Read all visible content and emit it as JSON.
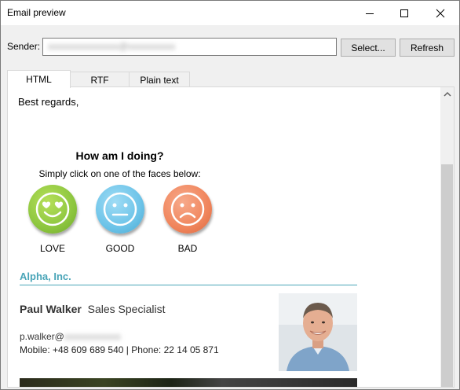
{
  "window": {
    "title": "Email preview"
  },
  "sender": {
    "label": "Sender:",
    "value": "xxxxxxxxxxxxxxx@xxxxxxxxxx"
  },
  "buttons": {
    "select": "Select...",
    "refresh": "Refresh"
  },
  "tabs": [
    {
      "label": "HTML",
      "active": true
    },
    {
      "label": "RTF",
      "active": false
    },
    {
      "label": "Plain text",
      "active": false
    }
  ],
  "email": {
    "greeting": "Best regards,",
    "survey": {
      "title": "How am I doing?",
      "subtitle": "Simply click on one of the faces below:",
      "faces": [
        {
          "label": "LOVE",
          "icon": "heart-eyes-face-icon",
          "color": "#8dc63f"
        },
        {
          "label": "GOOD",
          "icon": "neutral-face-icon",
          "color": "#6cc3e8"
        },
        {
          "label": "BAD",
          "icon": "sad-face-icon",
          "color": "#f0855c"
        }
      ]
    },
    "company": "Alpha, Inc.",
    "name": "Paul Walker",
    "job_title": "Sales Specialist",
    "email_prefix": "p.walker@",
    "email_domain_blurred": "xxxxxxxxxxxx",
    "phones": "Mobile:  +48 609 689 540 | Phone: 22 14 05 871"
  },
  "colors": {
    "accent": "#4aa5b8"
  }
}
